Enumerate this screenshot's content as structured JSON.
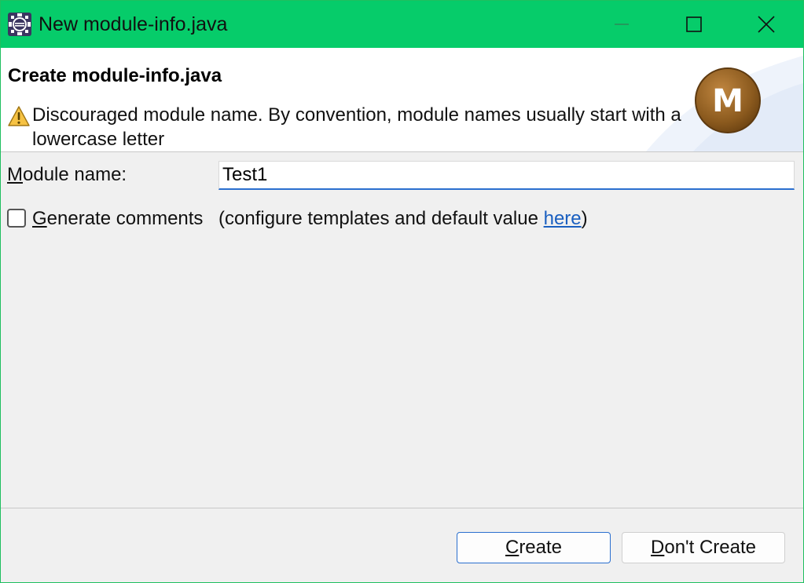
{
  "window": {
    "title": "New module-info.java",
    "titlebar_color": "#06cc6a",
    "icon": "eclipse-gear-icon"
  },
  "window_controls": {
    "minimize_icon": "minimize-icon",
    "maximize_icon": "maximize-icon",
    "close_icon": "close-icon"
  },
  "banner": {
    "title": "Create module-info.java",
    "warning_icon": "warning-icon",
    "message": "Discouraged module name. By convention, module names usually start with a lowercase letter",
    "logo_icon": "module-m-icon",
    "logo_letter": "M",
    "logo_color": "#8b5a1e"
  },
  "form": {
    "module_name_mnemonic": "M",
    "module_name_label_rest": "odule name:",
    "module_name_value": "Test1",
    "generate_comments_checked": false,
    "generate_comments_mnemonic": "G",
    "generate_comments_label_rest": "enerate comments",
    "configure_text_prefix": "(configure templates and default value ",
    "configure_link": "here",
    "configure_text_suffix": ")",
    "link_color": "#1a5fc0"
  },
  "buttons": {
    "create_mnemonic": "C",
    "create_rest": "reate",
    "dont_create_mnemonic": "D",
    "dont_create_rest": "on't Create"
  }
}
